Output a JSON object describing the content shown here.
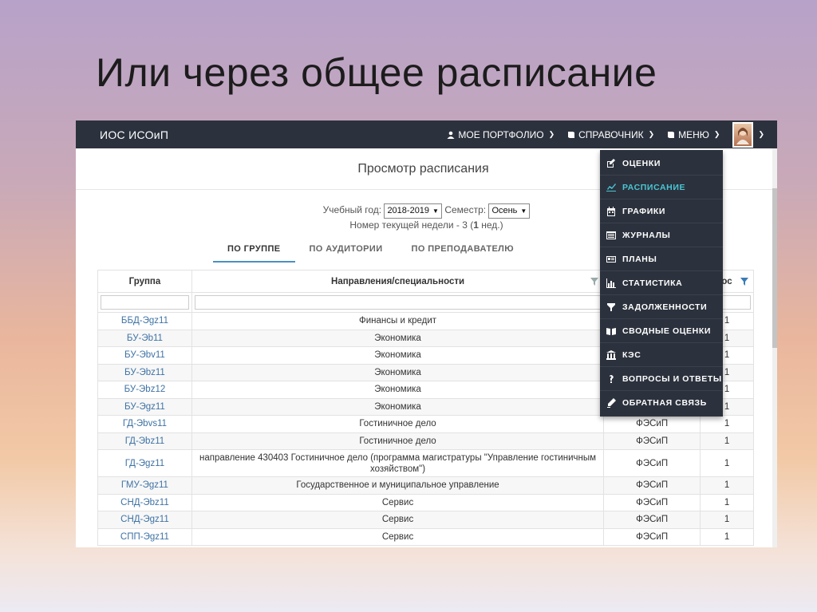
{
  "slide": {
    "title": "Или через общее расписание"
  },
  "navbar": {
    "brand": "ИОС ИСОиП",
    "items": [
      {
        "label": "МОЕ ПОРТФОЛИО",
        "icon": "user-icon"
      },
      {
        "label": "СПРАВОЧНИК",
        "icon": "book-icon"
      },
      {
        "label": "МЕНЮ",
        "icon": "book-icon"
      }
    ]
  },
  "page": {
    "title": "Просмотр расписания",
    "year_label": "Учебный год:",
    "year_value": "2018-2019",
    "semester_label": "Семестр:",
    "semester_value": "Осень",
    "week_text_prefix": "Номер текущей недели - 3 (",
    "week_number": "1",
    "week_text_suffix": " нед.)",
    "tabs": [
      "ПО ГРУППЕ",
      "ПО АУДИТОРИИ",
      "ПО ПРЕПОДАВАТЕЛЮ"
    ]
  },
  "table": {
    "headers": [
      "Группа",
      "Направления/специальности",
      "",
      "ос"
    ],
    "rows": [
      [
        "ББД-Эgz11",
        "Финансы и кредит",
        "",
        "1"
      ],
      [
        "БУ-Эb11",
        "Экономика",
        "",
        "1"
      ],
      [
        "БУ-Эbv11",
        "Экономика",
        "",
        "1"
      ],
      [
        "БУ-Эbz11",
        "Экономика",
        "",
        "1"
      ],
      [
        "БУ-Эbz12",
        "Экономика",
        "",
        "1"
      ],
      [
        "БУ-Эgz11",
        "Экономика",
        "",
        "1"
      ],
      [
        "ГД-Эbvs11",
        "Гостиничное дело",
        "ФЭСиП",
        "1"
      ],
      [
        "ГД-Эbz11",
        "Гостиничное дело",
        "ФЭСиП",
        "1"
      ],
      [
        "ГД-Эgz11",
        "направление 430403 Гостиничное дело (программа магистратуры \"Управление гостиничным хозяйством\")",
        "ФЭСиП",
        "1"
      ],
      [
        "ГМУ-Эgz11",
        "Государственное и муниципальное управление",
        "ФЭСиП",
        "1"
      ],
      [
        "СНД-Эbz11",
        "Сервис",
        "ФЭСиП",
        "1"
      ],
      [
        "СНД-Эgz11",
        "Сервис",
        "ФЭСиП",
        "1"
      ],
      [
        "СПП-Эgz11",
        "Сервис",
        "ФЭСиП",
        "1"
      ]
    ]
  },
  "menu": {
    "items": [
      {
        "label": "ОЦЕНКИ",
        "icon": "edit-icon",
        "active": false
      },
      {
        "label": "РАСПИСАНИЕ",
        "icon": "chart-line-icon",
        "active": true
      },
      {
        "label": "ГРАФИКИ",
        "icon": "calendar-icon",
        "active": false
      },
      {
        "label": "ЖУРНАЛЫ",
        "icon": "list-icon",
        "active": false
      },
      {
        "label": "ПЛАНЫ",
        "icon": "id-card-icon",
        "active": false
      },
      {
        "label": "СТАТИСТИКА",
        "icon": "bar-chart-icon",
        "active": false
      },
      {
        "label": "ЗАДОЛЖЕННОСТИ",
        "icon": "filter-icon",
        "active": false
      },
      {
        "label": "СВОДНЫЕ ОЦЕНКИ",
        "icon": "open-book-icon",
        "active": false
      },
      {
        "label": "КЭС",
        "icon": "institution-icon",
        "active": false
      },
      {
        "label": "ВОПРОСЫ И ОТВЕТЫ",
        "icon": "question-icon",
        "active": false
      },
      {
        "label": "ОБРАТНАЯ СВЯЗЬ",
        "icon": "pencil-icon",
        "active": false
      }
    ],
    "active_color": "#49c6d4"
  }
}
